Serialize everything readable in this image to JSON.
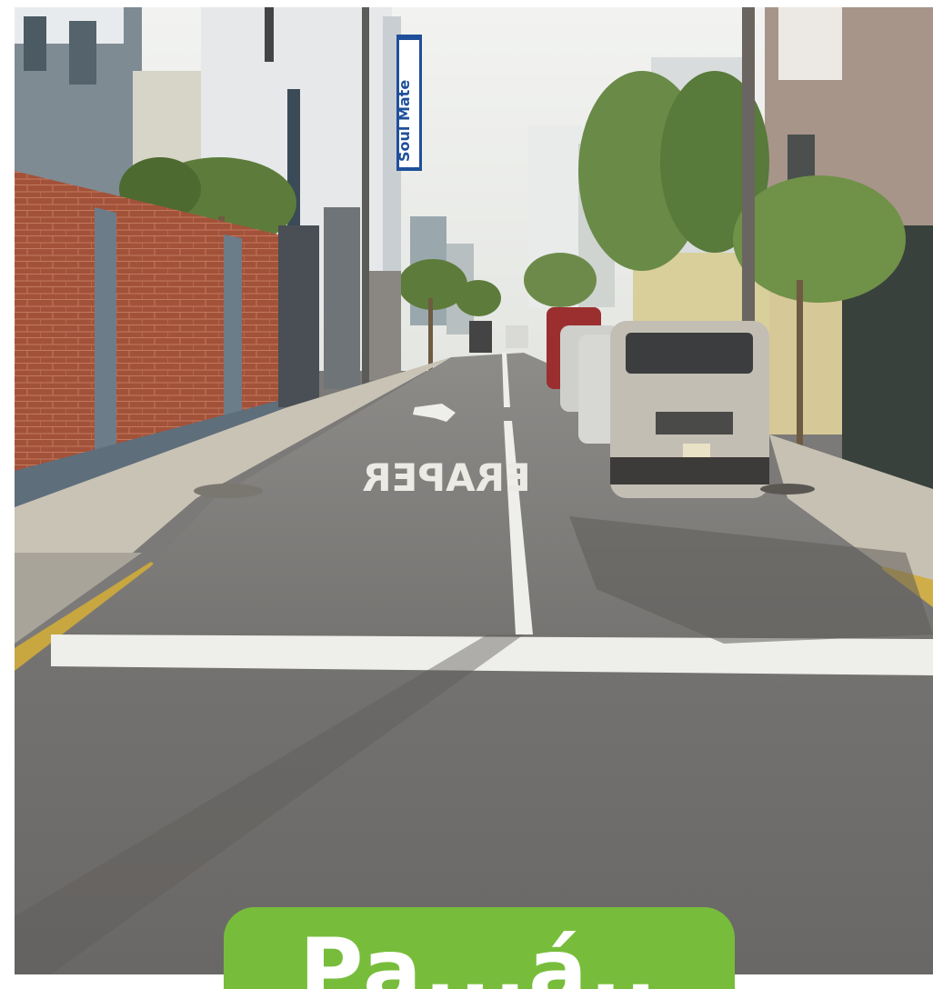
{
  "photo": {
    "subject": "street-scene",
    "shop_sign": "Soul Mate",
    "road_marking": "PARE",
    "road_marking_mirrored": "ERAPER"
  },
  "caption": {
    "text": "Pa...á..",
    "background_color": "#77bd3b",
    "text_color": "#ffffff"
  }
}
